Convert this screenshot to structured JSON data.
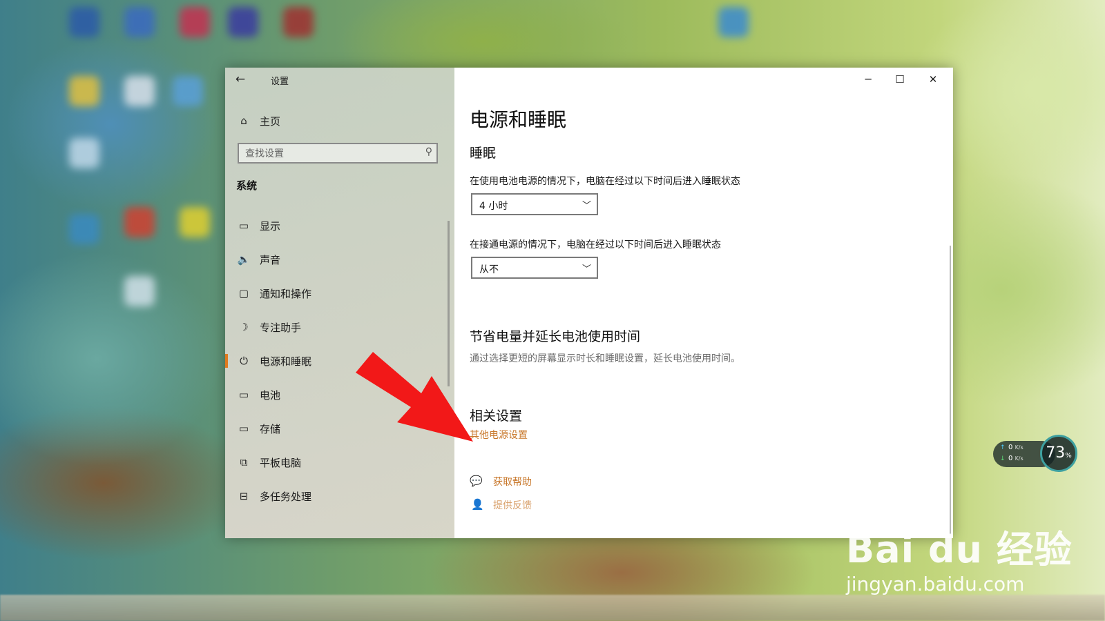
{
  "window": {
    "title": "设置"
  },
  "window_controls": {
    "minimize": "─",
    "maximize": "☐",
    "close": "✕"
  },
  "sidebar": {
    "home_label": "主页",
    "search_placeholder": "查找设置",
    "section_title": "系统",
    "items": [
      {
        "label": "显示",
        "icon": "monitor-icon",
        "glyph": "▭",
        "active": false
      },
      {
        "label": "声音",
        "icon": "speaker-icon",
        "glyph": "🔈",
        "active": false
      },
      {
        "label": "通知和操作",
        "icon": "notification-icon",
        "glyph": "▢",
        "active": false
      },
      {
        "label": "专注助手",
        "icon": "moon-icon",
        "glyph": "☽",
        "active": false
      },
      {
        "label": "电源和睡眠",
        "icon": "power-icon",
        "glyph": "⏻",
        "active": true
      },
      {
        "label": "电池",
        "icon": "battery-icon",
        "glyph": "▭",
        "active": false
      },
      {
        "label": "存储",
        "icon": "storage-icon",
        "glyph": "▭",
        "active": false
      },
      {
        "label": "平板电脑",
        "icon": "tablet-icon",
        "glyph": "⧉",
        "active": false
      },
      {
        "label": "多任务处理",
        "icon": "multitask-icon",
        "glyph": "⊟",
        "active": false
      }
    ]
  },
  "main": {
    "page_title": "电源和睡眠",
    "sleep_heading": "睡眠",
    "battery_sleep_label": "在使用电池电源的情况下，电脑在经过以下时间后进入睡眠状态",
    "battery_sleep_value": "4 小时",
    "plugged_sleep_label": "在接通电源的情况下，电脑在经过以下时间后进入睡眠状态",
    "plugged_sleep_value": "从不",
    "save_heading": "节省电量并延长电池使用时间",
    "save_desc": "通过选择更短的屏幕显示时长和睡眠设置，延长电池使用时间。",
    "related_heading": "相关设置",
    "related_link": "其他电源设置",
    "help_link": "获取帮助",
    "feedback_link": "提供反馈"
  },
  "net_widget": {
    "up_speed": "0",
    "down_speed": "0",
    "unit": "K/s",
    "percent": "73",
    "percent_sign": "%"
  },
  "watermark": {
    "logo": "Bai du 经验",
    "url": "jingyan.baidu.com"
  },
  "colors": {
    "accent": "#e07a1e",
    "link": "#c8772a",
    "arrow": "#f21818"
  }
}
